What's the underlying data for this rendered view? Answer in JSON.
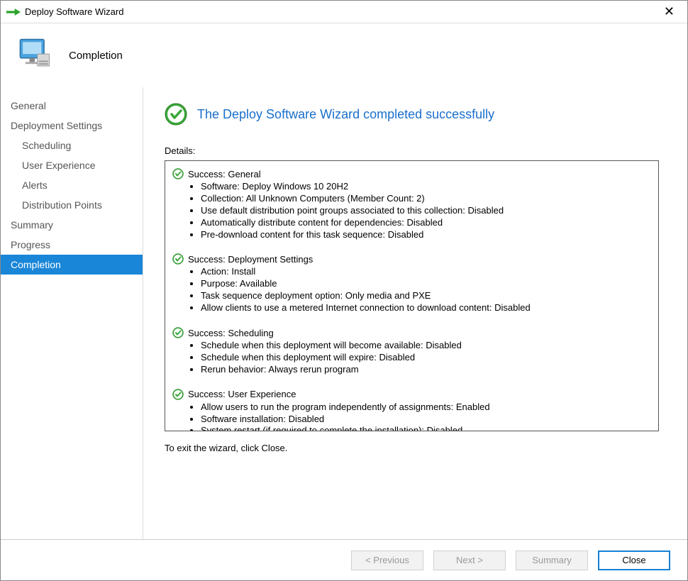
{
  "window": {
    "title": "Deploy Software Wizard"
  },
  "header": {
    "title": "Completion"
  },
  "sidebar": {
    "items": [
      {
        "label": "General",
        "child": false,
        "active": false
      },
      {
        "label": "Deployment Settings",
        "child": false,
        "active": false
      },
      {
        "label": "Scheduling",
        "child": true,
        "active": false
      },
      {
        "label": "User Experience",
        "child": true,
        "active": false
      },
      {
        "label": "Alerts",
        "child": true,
        "active": false
      },
      {
        "label": "Distribution Points",
        "child": true,
        "active": false
      },
      {
        "label": "Summary",
        "child": false,
        "active": false
      },
      {
        "label": "Progress",
        "child": false,
        "active": false
      },
      {
        "label": "Completion",
        "child": false,
        "active": true
      }
    ]
  },
  "content": {
    "success_title": "The Deploy Software Wizard completed successfully",
    "details_label": "Details:",
    "sections": [
      {
        "title": "Success: General",
        "items": [
          "Software: Deploy Windows 10 20H2",
          "Collection: All Unknown Computers (Member Count: 2)",
          "Use default distribution point groups associated to this collection: Disabled",
          "Automatically distribute content for dependencies: Disabled",
          "Pre-download content for this task sequence: Disabled"
        ]
      },
      {
        "title": "Success: Deployment Settings",
        "items": [
          "Action: Install",
          "Purpose: Available",
          "Task sequence deployment option: Only media and PXE",
          "Allow clients to use a metered Internet connection to download content: Disabled"
        ]
      },
      {
        "title": "Success: Scheduling",
        "items": [
          "Schedule when this deployment will become available: Disabled",
          "Schedule when this deployment will expire: Disabled",
          "Rerun behavior: Always rerun program"
        ]
      },
      {
        "title": "Success: User Experience",
        "items": [
          "Allow users to run the program independently of assignments: Enabled",
          "Software installation: Disabled",
          "System restart (if required to complete the installation): Disabled"
        ]
      }
    ],
    "exit_text": "To exit the wizard, click Close."
  },
  "footer": {
    "previous": "< Previous",
    "next": "Next >",
    "summary": "Summary",
    "close": "Close"
  }
}
